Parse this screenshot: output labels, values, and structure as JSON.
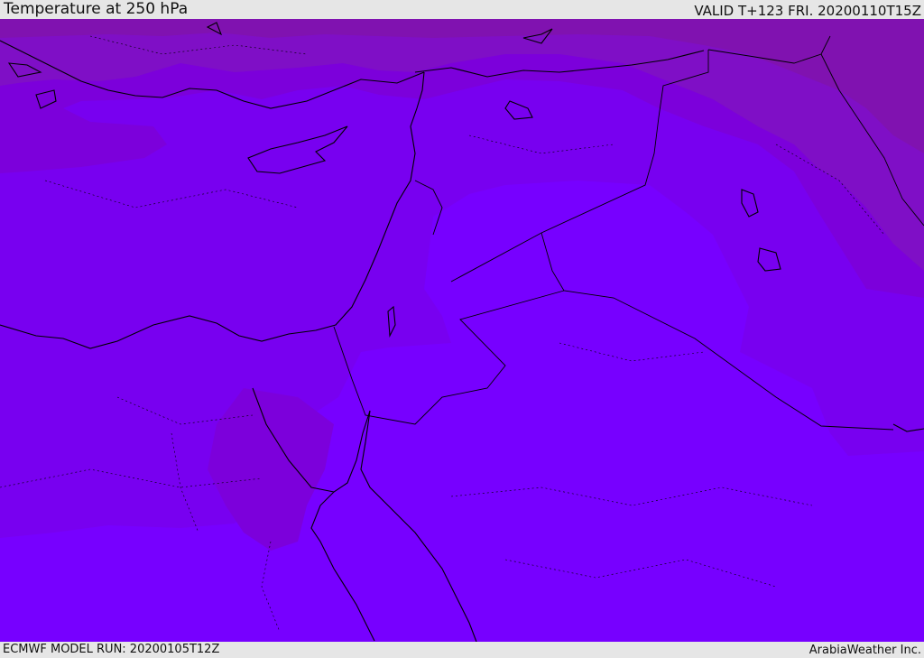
{
  "header": {
    "title": "Temperature at 250 hPa",
    "valid_time": "VALID T+123 FRI. 20200110T15Z"
  },
  "footer": {
    "model_run": "ECMWF MODEL RUN: 20200105T12Z",
    "credit": "ArabiaWeather Inc."
  },
  "map": {
    "field": "temperature",
    "level": "250 hPa",
    "colors": {
      "coldest": "#8012b0",
      "cold": "#7f0fc6",
      "mid": "#7c00db",
      "warm": "#7800f0",
      "warmest": "#7700ff",
      "coast": "#000000",
      "border": "#000000"
    }
  }
}
